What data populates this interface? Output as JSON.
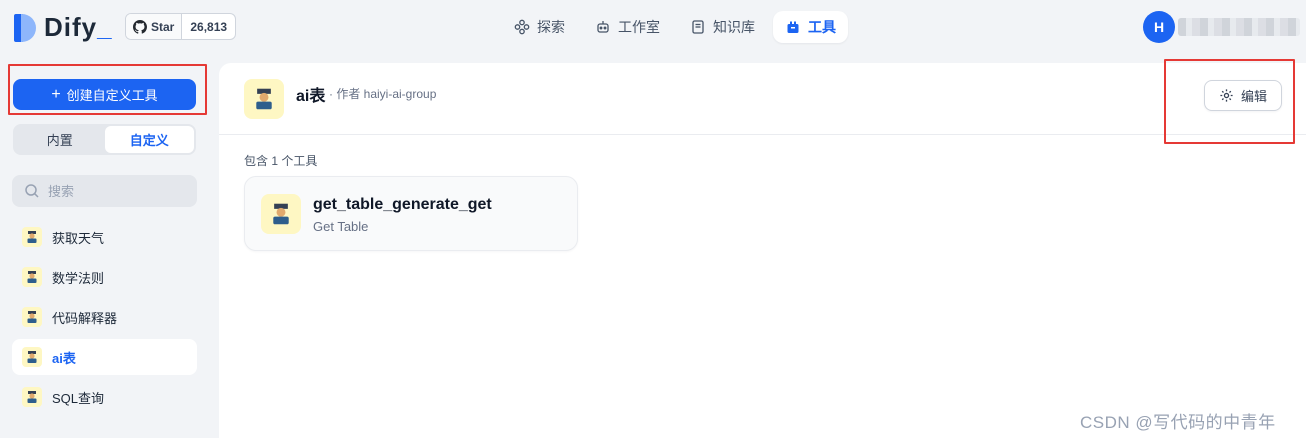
{
  "app": {
    "logo_text": "Dify",
    "logo_underscore": "_",
    "brand_color": "#1c64f2"
  },
  "github": {
    "star_label": "Star",
    "star_count": "26,813"
  },
  "nav": [
    {
      "label": "探索",
      "icon": "explore-icon",
      "active": false
    },
    {
      "label": "工作室",
      "icon": "robot-icon",
      "active": false
    },
    {
      "label": "知识库",
      "icon": "book-icon",
      "active": false
    },
    {
      "label": "工具",
      "icon": "toolbox-icon",
      "active": true
    }
  ],
  "user": {
    "avatar_initial": "H"
  },
  "sidebar": {
    "create_label": "创建自定义工具",
    "tabs": [
      {
        "label": "内置",
        "active": false
      },
      {
        "label": "自定义",
        "active": true
      }
    ],
    "search_placeholder": "搜索",
    "tools": [
      {
        "label": "获取天气",
        "active": false
      },
      {
        "label": "数学法则",
        "active": false
      },
      {
        "label": "代码解释器",
        "active": false
      },
      {
        "label": "ai表",
        "active": true
      },
      {
        "label": "SQL查询",
        "active": false
      }
    ]
  },
  "detail": {
    "name": "ai表",
    "author": "· 作者 haiyi-ai-group",
    "edit_label": "编辑",
    "contains_label": "包含 1 个工具",
    "tools": [
      {
        "name": "get_table_generate_get",
        "description": "Get Table"
      }
    ]
  },
  "watermark": "CSDN @写代码的中青年",
  "colors": {
    "highlight": "#e53935",
    "icon_bg": "#fef7c3"
  }
}
